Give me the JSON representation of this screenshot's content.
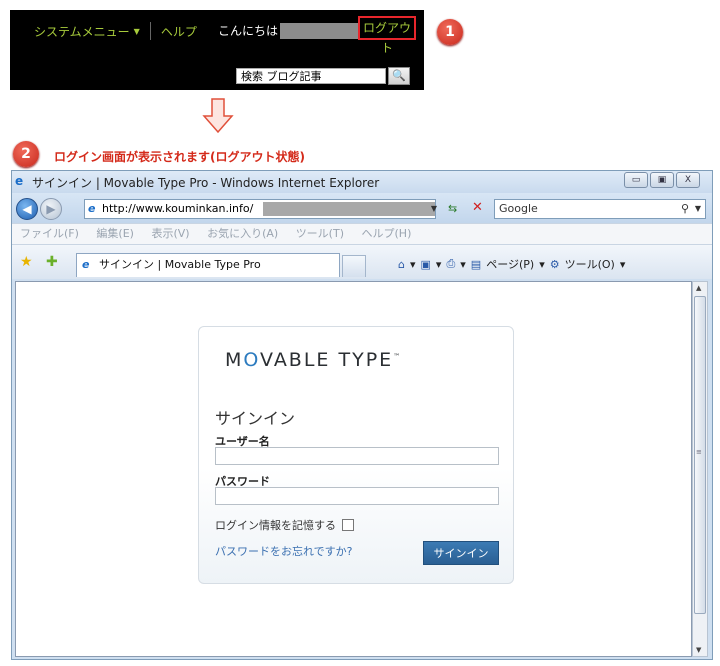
{
  "admin_bar": {
    "system_menu": "システムメニュー",
    "help": "ヘルプ",
    "greeting": "こんにちは",
    "logout": "ログアウト",
    "search_value": "検索 ブログ記事",
    "search_icon": "magnifier-icon"
  },
  "annotations": {
    "step1": "1",
    "step2": "2",
    "step2_text": "ログイン画面が表示されます(ログアウト状態)"
  },
  "browser": {
    "title": "サインイン | Movable Type Pro - Windows Internet Explorer",
    "window_buttons": [
      "▭",
      "▣",
      "X"
    ],
    "address": "http://www.kouminkan.info/",
    "search_engine": "Google",
    "menu": [
      "ファイル(F)",
      "編集(E)",
      "表示(V)",
      "お気に入り(A)",
      "ツール(T)",
      "ヘルプ(H)"
    ],
    "tab_title": "サインイン | Movable Type Pro",
    "command_page": "ページ(P)",
    "command_tools": "ツール(O)"
  },
  "login": {
    "logo_prefix": "M",
    "logo_o": "O",
    "logo_rest": "VABLE TYPE",
    "logo_tm": "™",
    "title": "サインイン",
    "username_label": "ユーザー名",
    "password_label": "パスワード",
    "remember_label": "ログイン情報を記憶する",
    "forgot_link": "パスワードをお忘れですか?",
    "signin_button": "サインイン"
  }
}
